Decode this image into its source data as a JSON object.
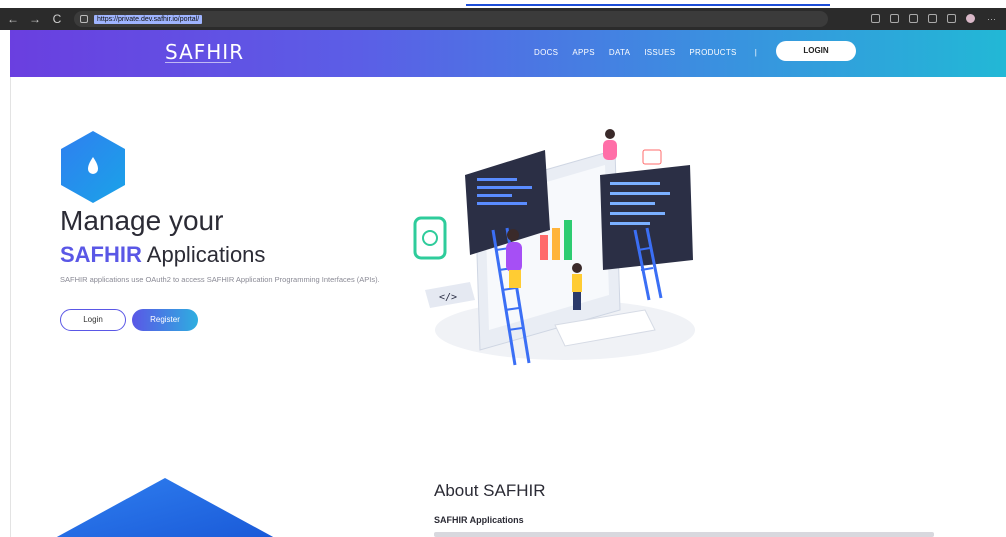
{
  "browser": {
    "url": "https://private.dev.safhir.io/portal/",
    "nav": {
      "back": "←",
      "forward": "→",
      "reload": "C"
    }
  },
  "header": {
    "logo": "SAFHIR",
    "menu": [
      "DOCS",
      "APPS",
      "DATA",
      "ISSUES",
      "PRODUCTS"
    ],
    "separator": "|",
    "login": "LOGIN"
  },
  "hero": {
    "title_line1": "Manage your",
    "title_brand": "SAFHIR",
    "title_rest": " Applications",
    "description": "SAFHIR applications use OAuth2 to access SAFHIR Application Programming Interfaces (APIs).",
    "login_button": "Login",
    "register_button": "Register"
  },
  "about": {
    "title": "About SAFHIR",
    "subtitle": "SAFHIR Applications"
  },
  "colors": {
    "brand_purple": "#5a57e6",
    "header_gradient_start": "#6a3fe0",
    "header_gradient_end": "#22b8d6"
  }
}
